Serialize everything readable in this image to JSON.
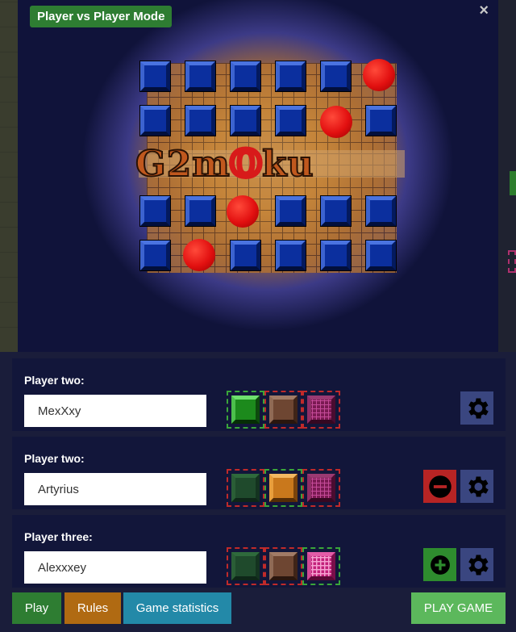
{
  "window": {
    "mode_badge": "Player vs Player Mode",
    "close_glyph": "×"
  },
  "splash": {
    "logo_parts": [
      "G2m",
      "O",
      "ku"
    ]
  },
  "players": [
    {
      "label": "Player two:",
      "name": "MexXxy",
      "selected_swatch": "green",
      "action": "none"
    },
    {
      "label": "Player two:",
      "name": "Artyrius",
      "selected_swatch": "brown",
      "action": "remove"
    },
    {
      "label": "Player three:",
      "name": "Alexxxey",
      "selected_swatch": "pink",
      "action": "add"
    }
  ],
  "swatches": [
    "green",
    "brown",
    "pink"
  ],
  "icons": {
    "gear": "gear-icon",
    "remove": "minus-circle-icon",
    "add": "plus-circle-icon",
    "close": "close-icon"
  },
  "footer": {
    "play": "Play",
    "rules": "Rules",
    "stats": "Game statistics",
    "play_game": "PLAY GAME"
  },
  "colors": {
    "play": "#2e7d32",
    "rules": "#b06a12",
    "stats": "#2389a8",
    "play_game": "#5cb85c",
    "panel": "#1a1d3a",
    "card": "#12163a"
  }
}
